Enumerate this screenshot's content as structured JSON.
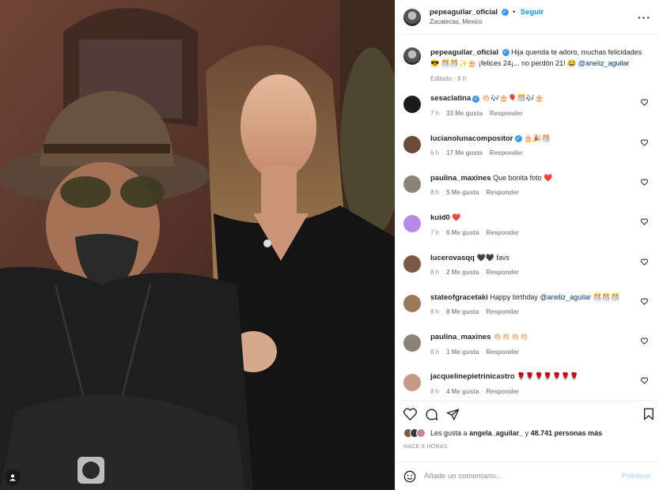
{
  "post": {
    "username": "pepeaguilar_oficial",
    "follow_label": "Seguir",
    "location": "Zacatecas, Mexico",
    "more_icon": "more-horizontal-icon",
    "caption": {
      "text": "Hija querida te adoro, muchas felicidades 😎 🎊🎊✨🎂 ¡felices 24¡... no perdón 21! 😂",
      "mention": "@aneliz_aguilar",
      "meta": "Editado · 8 h"
    },
    "comments": [
      {
        "user": "sesaclatina",
        "verified": true,
        "text": "👏🏻🎶🎂🎈🎊🎶🎂",
        "time": "7 h",
        "likes": "33 Me gusta",
        "reply": "Responder",
        "avatar_color": "#1c1c1c"
      },
      {
        "user": "lucianolunacompositor",
        "verified": true,
        "text": "🎂🎉🎊",
        "time": "6 h",
        "likes": "17 Me gusta",
        "reply": "Responder",
        "avatar_color": "#6b4a3a"
      },
      {
        "user": "paulina_maxines",
        "verified": false,
        "text": "Que bonita foto ❤️",
        "time": "8 h",
        "likes": "5 Me gusta",
        "reply": "Responder",
        "avatar_color": "#8c8278"
      },
      {
        "user": "kuid0",
        "verified": false,
        "text": "❤️",
        "time": "7 h",
        "likes": "6 Me gusta",
        "reply": "Responder",
        "avatar_color": "#b58be8"
      },
      {
        "user": "lucerovasqq",
        "verified": false,
        "text": "🖤🖤 favs",
        "time": "8 h",
        "likes": "2 Me gusta",
        "reply": "Responder",
        "avatar_color": "#7a5a44"
      },
      {
        "user": "stateofgracetaki",
        "verified": false,
        "text": "Happy birthday",
        "mention": "@aneliz_aguilar",
        "trail": "🎊🎊🎊",
        "time": "8 h",
        "likes": "8 Me gusta",
        "reply": "Responder",
        "avatar_color": "#9b7a5a"
      },
      {
        "user": "paulina_maxines",
        "verified": false,
        "text": "👏🏻👏🏻👏🏻👏🏻",
        "time": "8 h",
        "likes": "1 Me gusta",
        "reply": "Responder",
        "avatar_color": "#8c8278"
      },
      {
        "user": "jacquelinepietrinicastro",
        "verified": false,
        "text": "🌹🌹🌹🌹🌹🌹🌹",
        "time": "8 h",
        "likes": "4 Me gusta",
        "reply": "Responder",
        "avatar_color": "#c49a86"
      }
    ],
    "actions": {
      "like_icon": "heart-icon",
      "comment_icon": "comment-icon",
      "share_icon": "send-icon",
      "save_icon": "bookmark-icon"
    },
    "likes": {
      "prefix": "Les gusta a",
      "user": "angela_aguilar_",
      "middle": "y",
      "count": "48.741 personas más"
    },
    "time_ago": "HACE 8 HORAS",
    "add_comment": {
      "placeholder": "Añade un comentario...",
      "post_label": "Publicar",
      "emoji_icon": "smiley-icon"
    },
    "colors": {
      "link_blue": "#0095f6",
      "muted": "#8e8e8e",
      "mention": "#00376b"
    }
  }
}
